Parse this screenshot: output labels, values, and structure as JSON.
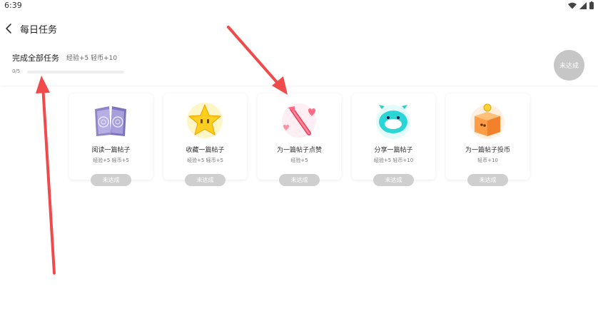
{
  "status_bar": {
    "time": "6:39"
  },
  "header": {
    "title": "每日任务"
  },
  "summary": {
    "title": "完成全部任务",
    "reward": "经验+5 轻币+10",
    "progress_text": "0/5",
    "progress_fraction": 0,
    "button_label": "未达成"
  },
  "tasks": [
    {
      "title": "阅读一篇帖子",
      "reward": "经验+5 轻币+5",
      "button_label": "未达成",
      "icon": "book-icon"
    },
    {
      "title": "收藏一篇帖子",
      "reward": "经验+5 轻币+5",
      "button_label": "未达成",
      "icon": "star-icon"
    },
    {
      "title": "为一篇帖子点赞",
      "reward": "经验+5",
      "button_label": "未达成",
      "icon": "heart-wand-icon"
    },
    {
      "title": "分享一篇帖子",
      "reward": "经验+5 轻币+10",
      "button_label": "未达成",
      "icon": "share-monster-icon"
    },
    {
      "title": "为一篇帖子投币",
      "reward": "轻币+10",
      "button_label": "未达成",
      "icon": "coin-box-icon"
    }
  ],
  "colors": {
    "annotation_arrow": "#f04a4a",
    "button_disabled": "#cfcfcf"
  }
}
